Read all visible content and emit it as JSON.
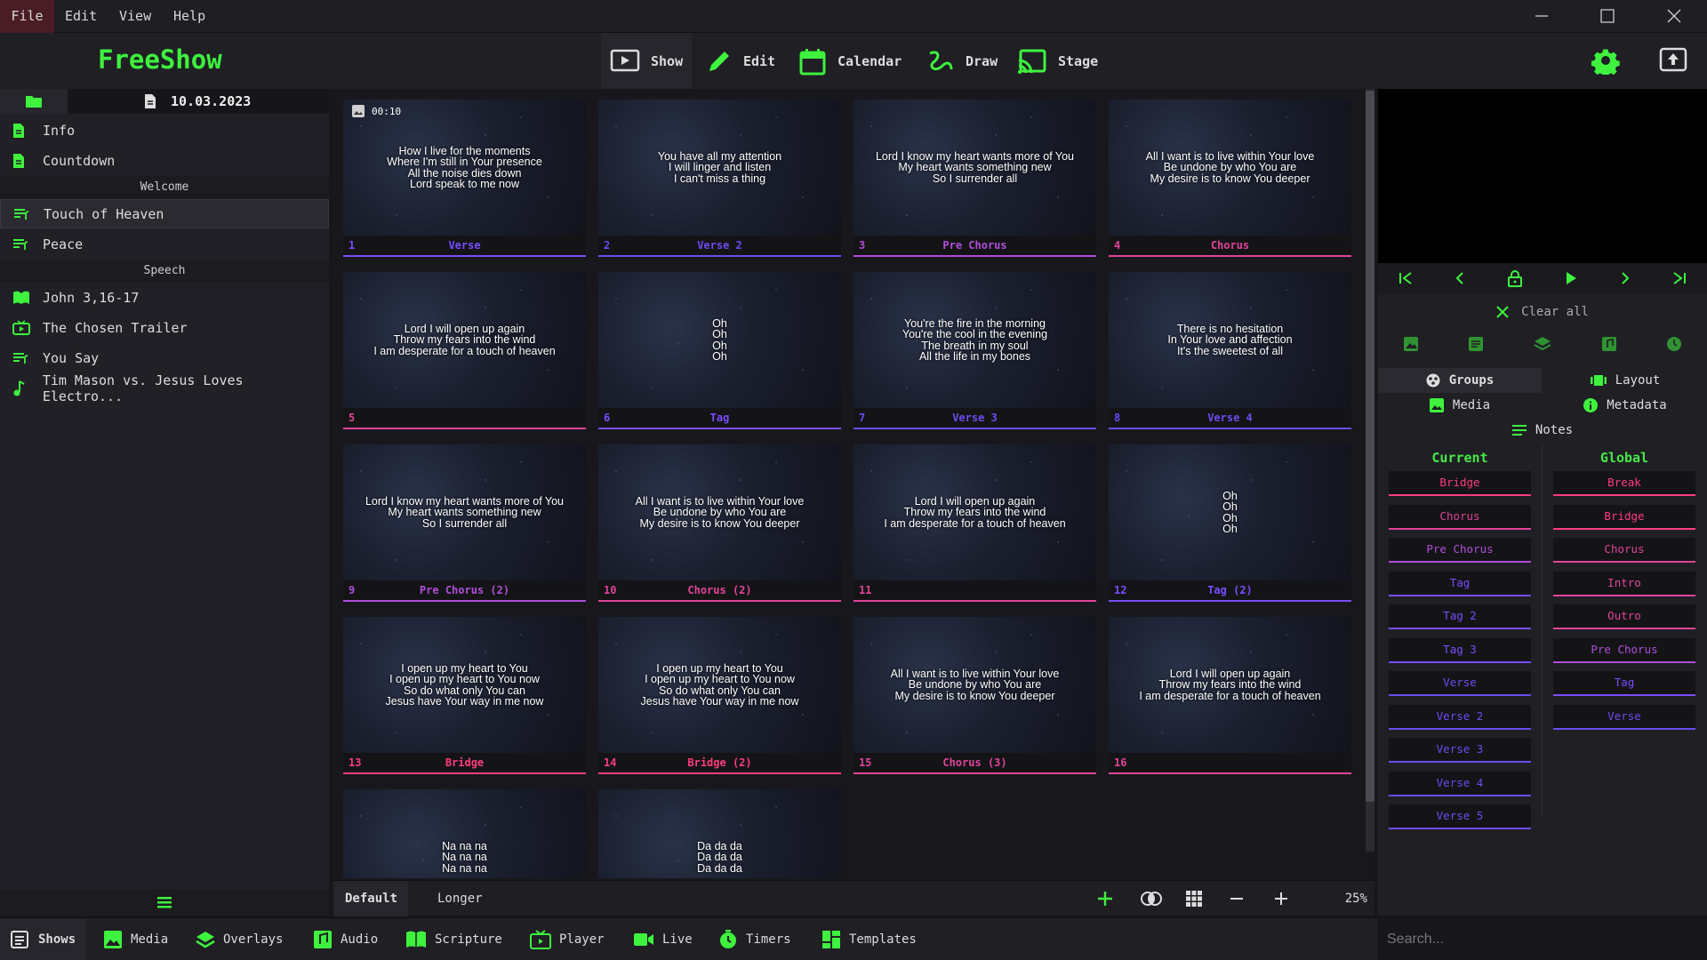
{
  "menu": [
    "File",
    "Edit",
    "View",
    "Help"
  ],
  "app": {
    "title": "FreeShow"
  },
  "nav": {
    "show": "Show",
    "edit": "Edit",
    "calendar": "Calendar",
    "draw": "Draw",
    "stage": "Stage"
  },
  "project": {
    "date": "10.03.2023",
    "items": [
      {
        "type": "doc",
        "label": "Info"
      },
      {
        "type": "doc",
        "label": "Countdown"
      },
      {
        "type": "section",
        "label": "Welcome"
      },
      {
        "type": "show",
        "label": "Touch of Heaven",
        "selected": true
      },
      {
        "type": "show",
        "label": "Peace"
      },
      {
        "type": "section",
        "label": "Speech"
      },
      {
        "type": "scripture",
        "label": "John 3,16-17"
      },
      {
        "type": "player",
        "label": "The Chosen Trailer"
      },
      {
        "type": "show",
        "label": "You Say"
      },
      {
        "type": "audio",
        "label": "Tim Mason vs. Jesus Loves Electro..."
      }
    ]
  },
  "slides": [
    {
      "num": "1",
      "group": "Verse",
      "color": "#7a4dff",
      "timer": "00:10",
      "lines": [
        "How I live for the moments",
        "Where I'm still in Your presence",
        "All the noise dies down",
        "Lord speak to me now"
      ]
    },
    {
      "num": "2",
      "group": "Verse 2",
      "color": "#6e4bf0",
      "lines": [
        "You have all my attention",
        "I will linger and listen",
        "I can't miss a thing"
      ]
    },
    {
      "num": "3",
      "group": "Pre Chorus",
      "color": "#b04ed8",
      "lines": [
        "Lord I know my heart wants more of You",
        "My heart wants something new",
        "So I surrender all"
      ]
    },
    {
      "num": "4",
      "group": "Chorus",
      "color": "#e0449a",
      "lines": [
        "All I want is to live within Your love",
        "Be undone by who You are",
        "My desire is to know You deeper"
      ]
    },
    {
      "num": "5",
      "group": "",
      "color": "#e0449a",
      "lines": [
        "Lord I will open up again",
        "Throw my fears into the wind",
        "I am desperate for a touch of heaven"
      ]
    },
    {
      "num": "6",
      "group": "Tag",
      "color": "#7a4dff",
      "lines": [
        "Oh",
        "Oh",
        "Oh",
        "Oh"
      ]
    },
    {
      "num": "7",
      "group": "Verse 3",
      "color": "#6e4bf0",
      "lines": [
        "You're the fire in the morning",
        "You're the cool in the evening",
        "The breath in my soul",
        "All the life in my bones"
      ]
    },
    {
      "num": "8",
      "group": "Verse 4",
      "color": "#6e4bf0",
      "lines": [
        "There is no hesitation",
        "In Your love and affection",
        "It's the sweetest of all"
      ]
    },
    {
      "num": "9",
      "group": "Pre Chorus (2)",
      "color": "#b04ed8",
      "lines": [
        "Lord I know my heart wants more of You",
        "My heart wants something new",
        "So I surrender all"
      ]
    },
    {
      "num": "10",
      "group": "Chorus (2)",
      "color": "#e0449a",
      "lines": [
        "All I want is to live within Your love",
        "Be undone by who You are",
        "My desire is to know You deeper"
      ]
    },
    {
      "num": "11",
      "group": "",
      "color": "#e0449a",
      "lines": [
        "Lord I will open up again",
        "Throw my fears into the wind",
        "I am desperate for a touch of heaven"
      ]
    },
    {
      "num": "12",
      "group": "Tag (2)",
      "color": "#7a4dff",
      "lines": [
        "Oh",
        "Oh",
        "Oh",
        "Oh"
      ]
    },
    {
      "num": "13",
      "group": "Bridge",
      "color": "#ff3d7f",
      "lines": [
        "I open up my heart to You",
        "I open up my heart to You now",
        "So do what only You can",
        "Jesus have Your way in me now"
      ]
    },
    {
      "num": "14",
      "group": "Bridge (2)",
      "color": "#ff3d7f",
      "lines": [
        "I open up my heart to You",
        "I open up my heart to You now",
        "So do what only You can",
        "Jesus have Your way in me now"
      ]
    },
    {
      "num": "15",
      "group": "Chorus (3)",
      "color": "#e0449a",
      "lines": [
        "All I want is to live within Your love",
        "Be undone by who You are",
        "My desire is to know You deeper"
      ]
    },
    {
      "num": "16",
      "group": "",
      "color": "#e0449a",
      "lines": [
        "Lord I will open up again",
        "Throw my fears into the wind",
        "I am desperate for a touch of heaven"
      ]
    },
    {
      "num": "",
      "group": "",
      "color": "#7a4dff",
      "lines": [
        "Na na na",
        "Na na na",
        "Na na na"
      ]
    },
    {
      "num": "",
      "group": "",
      "color": "#7a4dff",
      "lines": [
        "Da da da",
        "Da da da",
        "Da da da"
      ]
    }
  ],
  "layouts": [
    "Default",
    "Longer"
  ],
  "zoom": "25%",
  "right": {
    "clear_all": "Clear all",
    "tabs": {
      "groups": "Groups",
      "layout": "Layout",
      "media": "Media",
      "metadata": "Metadata",
      "notes": "Notes"
    },
    "current_title": "Current",
    "global_title": "Global",
    "current": [
      {
        "label": "Bridge",
        "color": "#ff3d7f"
      },
      {
        "label": "Chorus",
        "color": "#e0449a"
      },
      {
        "label": "Pre Chorus",
        "color": "#b04ed8"
      },
      {
        "label": "Tag",
        "color": "#7a4dff"
      },
      {
        "label": "Tag 2",
        "color": "#7a4dff"
      },
      {
        "label": "Tag 3",
        "color": "#7a4dff"
      },
      {
        "label": "Verse",
        "color": "#6e4bf0"
      },
      {
        "label": "Verse 2",
        "color": "#6e4bf0"
      },
      {
        "label": "Verse 3",
        "color": "#6e4bf0"
      },
      {
        "label": "Verse 4",
        "color": "#6e4bf0"
      },
      {
        "label": "Verse 5",
        "color": "#6e4bf0"
      }
    ],
    "global": [
      {
        "label": "Break",
        "color": "#ff3d7f"
      },
      {
        "label": "Bridge",
        "color": "#ff3d7f"
      },
      {
        "label": "Chorus",
        "color": "#e0449a"
      },
      {
        "label": "Intro",
        "color": "#e0449a"
      },
      {
        "label": "Outro",
        "color": "#e0449a"
      },
      {
        "label": "Pre Chorus",
        "color": "#b04ed8"
      },
      {
        "label": "Tag",
        "color": "#7a4dff"
      },
      {
        "label": "Verse",
        "color": "#6e4bf0"
      }
    ]
  },
  "bottom": {
    "shows": "Shows",
    "media": "Media",
    "overlays": "Overlays",
    "audio": "Audio",
    "scripture": "Scripture",
    "player": "Player",
    "live": "Live",
    "timers": "Timers",
    "templates": "Templates"
  },
  "search": {
    "placeholder": "Search..."
  },
  "colors": {
    "accent": "#3ef23e",
    "background": "#18181c"
  }
}
